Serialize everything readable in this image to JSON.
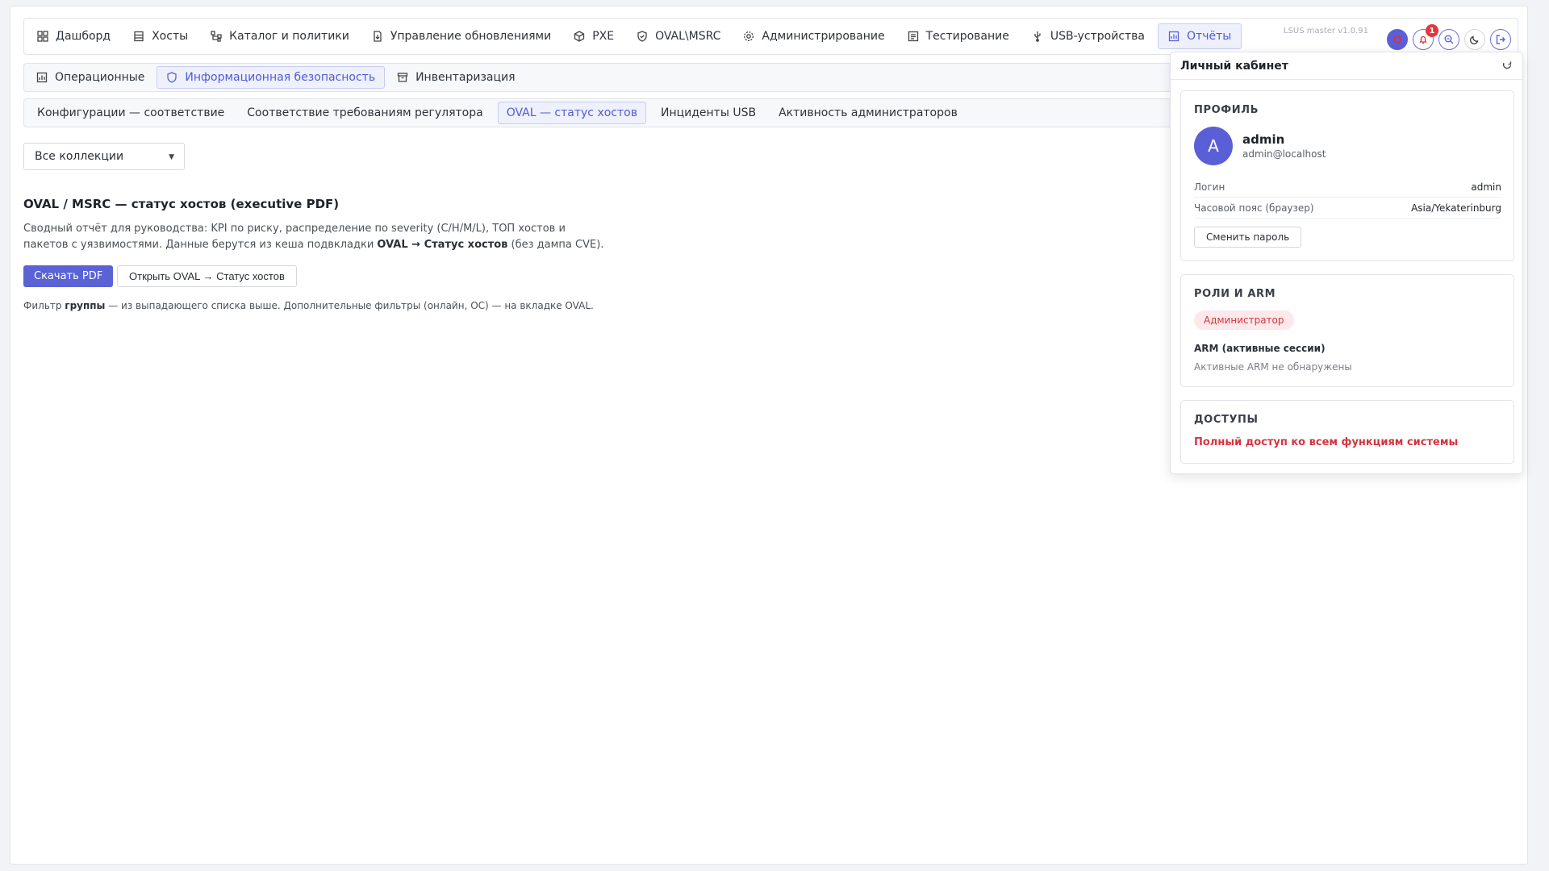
{
  "nav": {
    "items": [
      {
        "label": "Дашборд",
        "icon": "dashboard-icon"
      },
      {
        "label": "Хосты",
        "icon": "server-icon"
      },
      {
        "label": "Каталог и политики",
        "icon": "hierarchy-icon"
      },
      {
        "label": "Управление обновлениями",
        "icon": "file-update-icon"
      },
      {
        "label": "PXE",
        "icon": "cube-icon"
      },
      {
        "label": "OVAL\\MSRC",
        "icon": "shield-icon"
      },
      {
        "label": "Администрирование",
        "icon": "gear-icon"
      },
      {
        "label": "Тестирование",
        "icon": "checklist-icon"
      },
      {
        "label": "USB-устройства",
        "icon": "usb-icon"
      },
      {
        "label": "Отчёты",
        "icon": "report-icon"
      }
    ],
    "active": "Отчёты",
    "version": "LSUS master v1.0.91",
    "notification_count": "1"
  },
  "subnav": {
    "items": [
      {
        "label": "Операционные",
        "icon": "report-icon"
      },
      {
        "label": "Информационная безопасность",
        "icon": "shield-icon"
      },
      {
        "label": "Инвентаризация",
        "icon": "archive-icon"
      }
    ],
    "active": "Информационная безопасность"
  },
  "reportnav": {
    "items": [
      "Конфигурации — соответствие",
      "Соответствие требованиям регулятора",
      "OVAL — статус хостов",
      "Инциденты USB",
      "Активность администраторов"
    ],
    "active": "OVAL — статус хостов"
  },
  "filter": {
    "collection": "Все коллекции"
  },
  "report": {
    "title": "OVAL / MSRC — статус хостов (executive PDF)",
    "desc_part1": "Сводный отчёт для руководства: KPI по риску, распределение по severity (C/H/M/L), ТОП хостов и пакетов с уязвимостями. Данные берутся из кеша подвкладки ",
    "desc_bold": "OVAL → Статус хостов",
    "desc_part2": " (без дампа CVE).",
    "download_label": "Скачать PDF",
    "open_label": "Открыть OVAL → Статус хостов",
    "note_part1": "Фильтр ",
    "note_bold": "группы",
    "note_part2": " — из выпадающего списка выше. Дополнительные фильтры (онлайн, ОС) — на вкладке OVAL."
  },
  "profile_panel": {
    "title": "Личный кабинет",
    "profile": {
      "section_title": "ПРОФИЛЬ",
      "avatar_letter": "A",
      "username": "admin",
      "email": "admin@localhost",
      "login_label": "Логин",
      "login_value": "admin",
      "tz_label": "Часовой пояс (браузер)",
      "tz_value": "Asia/Yekaterinburg",
      "change_password": "Сменить пароль"
    },
    "roles": {
      "section_title": "РОЛИ И ARM",
      "role": "Администратор",
      "arm_title": "ARM (активные сессии)",
      "arm_empty": "Активные ARM не обнаружены"
    },
    "access": {
      "section_title": "ДОСТУПЫ",
      "text": "Полный доступ ко всем функциям системы"
    }
  },
  "colors": {
    "accent": "#5a62d6",
    "danger": "#d6343f"
  }
}
